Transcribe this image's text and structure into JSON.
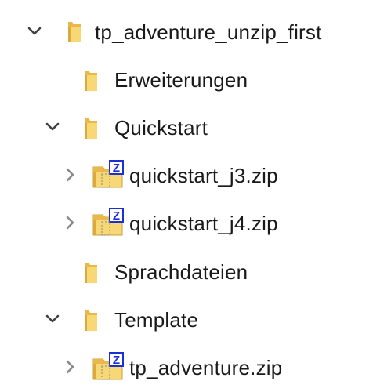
{
  "tree": {
    "root": {
      "label": "tp_adventure_unzip_first",
      "icon": "folder-icon",
      "expanded": true
    },
    "items": [
      {
        "label": "Erweiterungen",
        "icon": "folder-icon",
        "expandable": false
      },
      {
        "label": "Quickstart",
        "icon": "folder-icon",
        "expandable": true,
        "expanded": true
      },
      {
        "label": "quickstart_j3.zip",
        "icon": "zip-icon",
        "expandable": true,
        "expanded": false
      },
      {
        "label": "quickstart_j4.zip",
        "icon": "zip-icon",
        "expandable": true,
        "expanded": false
      },
      {
        "label": "Sprachdateien",
        "icon": "folder-icon",
        "expandable": false
      },
      {
        "label": "Template",
        "icon": "folder-icon",
        "expandable": true,
        "expanded": true
      },
      {
        "label": "tp_adventure.zip",
        "icon": "zip-icon",
        "expandable": true,
        "expanded": false
      }
    ]
  },
  "colors": {
    "folder_body": "#f8d775",
    "folder_tab": "#e8b84a",
    "folder_shade": "#dca93a",
    "chevron": "#404040",
    "chevron_collapsed": "#8a8a8a",
    "zip_badge": "#1c2fd0",
    "text": "#1a1a1a"
  },
  "zip_badge_letter": "Z"
}
